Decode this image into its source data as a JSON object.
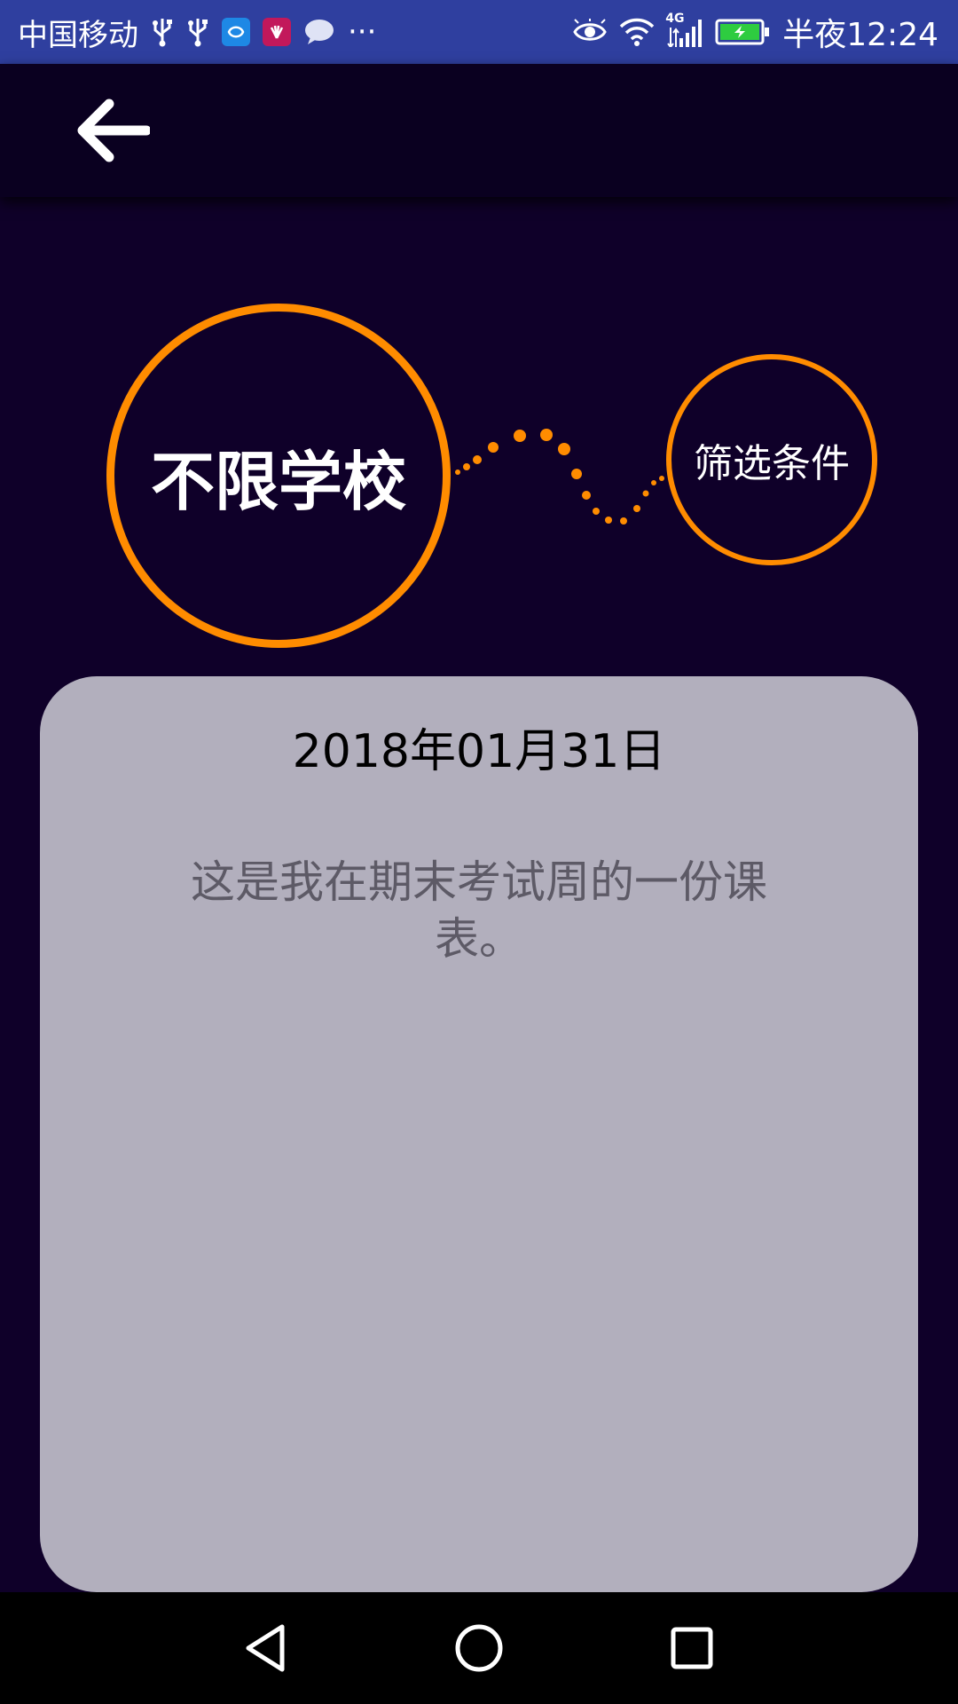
{
  "status_bar": {
    "carrier": "中国移动",
    "overflow": "···",
    "network": "4G",
    "time": "半夜12:24",
    "icons": [
      "usb-icon",
      "usb-icon",
      "app-icon",
      "huawei-icon",
      "message-icon",
      "eye-icon",
      "wifi-icon",
      "signal-icon",
      "battery-charging-icon"
    ]
  },
  "header": {
    "back_icon": "arrow-left-icon"
  },
  "selectors": {
    "school": "不限学校",
    "filter": "筛选条件"
  },
  "card": {
    "date": "2018年01月31日",
    "text": "这是我在期末考试周的一份课表。"
  },
  "nav": {
    "icons": [
      "back-triangle-icon",
      "home-circle-icon",
      "recents-square-icon"
    ]
  },
  "colors": {
    "background": "#0f0029",
    "accent": "#ff8c00",
    "card": "#b2afbd",
    "status_bar": "#2f3f9f"
  }
}
